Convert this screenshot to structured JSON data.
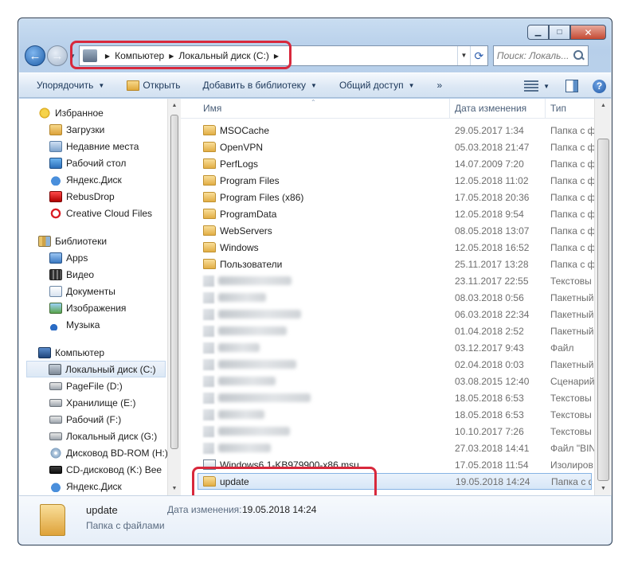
{
  "window": {
    "controls": {
      "minimize": "▁",
      "maximize": "□",
      "close": "✕"
    }
  },
  "nav": {
    "address": {
      "crumbs": [
        "Компьютер",
        "Локальный диск (C:)"
      ]
    },
    "search": {
      "placeholder": "Поиск: Локаль..."
    }
  },
  "toolbar": {
    "organize": "Упорядочить",
    "open": "Открыть",
    "add_to_library": "Добавить в библиотеку",
    "share": "Общий доступ",
    "more": "»"
  },
  "sidebar": {
    "favorites": {
      "header": "Избранное",
      "items": [
        "Загрузки",
        "Недавние места",
        "Рабочий стол",
        "Яндекс.Диск",
        "RebusDrop",
        "Creative Cloud Files"
      ]
    },
    "libraries": {
      "header": "Библиотеки",
      "items": [
        "Apps",
        "Видео",
        "Документы",
        "Изображения",
        "Музыка"
      ]
    },
    "computer": {
      "header": "Компьютер",
      "items": [
        "Локальный диск (C:)",
        "PageFile (D:)",
        "Хранилище (E:)",
        "Рабочий (F:)",
        "Локальный диск (G:)",
        "Дисковод BD-ROM (H:)",
        "CD-дисковод (K:) Bee",
        "Яндекс.Диск"
      ]
    }
  },
  "columns": {
    "name": "Имя",
    "date": "Дата изменения",
    "type": "Тип"
  },
  "files": [
    {
      "name": "MSOCache",
      "date": "29.05.2017 1:34",
      "type": "Папка с ф"
    },
    {
      "name": "OpenVPN",
      "date": "05.03.2018 21:47",
      "type": "Папка с ф"
    },
    {
      "name": "PerfLogs",
      "date": "14.07.2009 7:20",
      "type": "Папка с ф"
    },
    {
      "name": "Program Files",
      "date": "12.05.2018 11:02",
      "type": "Папка с ф"
    },
    {
      "name": "Program Files (x86)",
      "date": "17.05.2018 20:36",
      "type": "Папка с ф"
    },
    {
      "name": "ProgramData",
      "date": "12.05.2018 9:54",
      "type": "Папка с ф"
    },
    {
      "name": "WebServers",
      "date": "08.05.2018 13:07",
      "type": "Папка с ф"
    },
    {
      "name": "Windows",
      "date": "12.05.2018 16:52",
      "type": "Папка с ф"
    },
    {
      "name": "Пользователи",
      "date": "25.11.2017 13:28",
      "type": "Папка с ф"
    }
  ],
  "blurred_files": [
    {
      "date": "23.11.2017 22:55",
      "type": "Текстовы"
    },
    {
      "date": "08.03.2018 0:56",
      "type": "Пакетный"
    },
    {
      "date": "06.03.2018 22:34",
      "type": "Пакетный"
    },
    {
      "date": "01.04.2018 2:52",
      "type": "Пакетный"
    },
    {
      "date": "03.12.2017 9:43",
      "type": "Файл"
    },
    {
      "date": "02.04.2018 0:03",
      "type": "Пакетный"
    },
    {
      "date": "03.08.2015 12:40",
      "type": "Сценарий"
    },
    {
      "date": "18.05.2018 6:53",
      "type": "Текстовы"
    },
    {
      "date": "18.05.2018 6:53",
      "type": "Текстовы"
    },
    {
      "date": "10.10.2017 7:26",
      "type": "Текстовы"
    },
    {
      "date": "27.03.2018 14:41",
      "type": "Файл \"BIN"
    }
  ],
  "highlighted_files": [
    {
      "name": "Windows6.1-KB979900-x86.msu",
      "date": "17.05.2018 11:54",
      "type": "Изолиров"
    },
    {
      "name": "update",
      "date": "19.05.2018 14:24",
      "type": "Папка с ф"
    }
  ],
  "details": {
    "name": "update",
    "type": "Папка с файлами",
    "date_label": "Дата изменения:",
    "date_value": "19.05.2018 14:24"
  }
}
